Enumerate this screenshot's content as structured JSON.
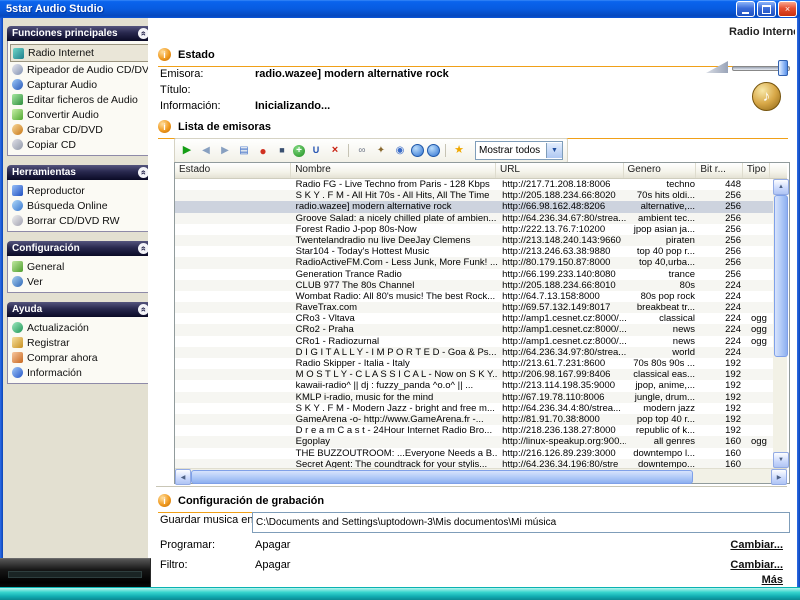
{
  "colors": {
    "accent_orange": "#F0A018",
    "title_blue": "#0A55D8",
    "selection_gray": "#CDD3DE",
    "teal_strip": "#17BFC0"
  },
  "window": {
    "title": "5star Audio Studio"
  },
  "page": {
    "section_label": "Radio Internet"
  },
  "sidebar": {
    "sections": [
      {
        "title": "Funciones principales",
        "items": [
          {
            "label": "Radio Internet",
            "icon": "radio-icon",
            "active": true
          },
          {
            "label": "Ripeador de Audio CD/DVD",
            "icon": "cd-rip-icon"
          },
          {
            "label": "Capturar Audio",
            "icon": "capture-audio-icon"
          },
          {
            "label": "Editar ficheros de Audio",
            "icon": "edit-audio-icon"
          },
          {
            "label": "Convertir Audio",
            "icon": "convert-audio-icon"
          },
          {
            "label": "Grabar CD/DVD",
            "icon": "burn-cd-icon"
          },
          {
            "label": "Copiar CD",
            "icon": "copy-cd-icon"
          }
        ]
      },
      {
        "title": "Herramientas",
        "items": [
          {
            "label": "Reproductor",
            "icon": "player-icon"
          },
          {
            "label": "Búsqueda Online",
            "icon": "online-search-icon"
          },
          {
            "label": "Borrar CD/DVD RW",
            "icon": "erase-cd-icon"
          }
        ]
      },
      {
        "title": "Configuración",
        "items": [
          {
            "label": "General",
            "icon": "general-icon"
          },
          {
            "label": "Ver",
            "icon": "view-icon"
          }
        ]
      },
      {
        "title": "Ayuda",
        "items": [
          {
            "label": "Actualización",
            "icon": "update-icon"
          },
          {
            "label": "Registrar",
            "icon": "register-icon"
          },
          {
            "label": "Comprar ahora",
            "icon": "buy-icon"
          },
          {
            "label": "Información",
            "icon": "info-item-icon"
          }
        ]
      }
    ]
  },
  "main": {
    "estado": {
      "title": "Estado",
      "fields": [
        {
          "label": "Emisora:",
          "value": "radio.wazee] modern alternative rock"
        },
        {
          "label": "Título:",
          "value": ""
        },
        {
          "label": "Información:",
          "value": "Inicializando..."
        }
      ]
    },
    "lista": {
      "title": "Lista de emisoras",
      "toolbar": {
        "buttons": [
          "play",
          "previous",
          "next",
          "playlist",
          "record",
          "stop",
          "add",
          "add-url",
          "delete",
          "connect",
          "tools",
          "preview",
          "internet",
          "online",
          "favorites"
        ],
        "filter_value": "Mostrar todos"
      },
      "columns": [
        {
          "label": "Estado",
          "key": "estado"
        },
        {
          "label": "Nombre",
          "key": "nombre"
        },
        {
          "label": "URL",
          "key": "url"
        },
        {
          "label": "Genero",
          "key": "genero"
        },
        {
          "label": "Bit r...",
          "key": "bit"
        },
        {
          "label": "Tipo",
          "key": "tipo"
        }
      ],
      "selected_index": 2,
      "rows": [
        {
          "estado": "",
          "nombre": "Radio FG - Live Techno from Paris - 128 Kbps",
          "url": "http://217.71.208.18:8006",
          "genero": "techno",
          "bit": "448",
          "tipo": ""
        },
        {
          "estado": "",
          "nombre": "S K Y . F M - All Hit 70s - All Hits, All The Time",
          "url": "http://205.188.234.66:8020",
          "genero": "70s hits oldi...",
          "bit": "256",
          "tipo": ""
        },
        {
          "estado": "",
          "nombre": "radio.wazee] modern alternative rock",
          "url": "http://66.98.162.48:8206",
          "genero": "alternative,...",
          "bit": "256",
          "tipo": ""
        },
        {
          "estado": "",
          "nombre": "Groove Salad: a nicely chilled plate of ambien...",
          "url": "http://64.236.34.67:80/strea...",
          "genero": "ambient tec...",
          "bit": "256",
          "tipo": ""
        },
        {
          "estado": "",
          "nombre": "Forest Radio J-pop 80s-Now",
          "url": "http://222.13.76.7:10200",
          "genero": "jpop asian ja...",
          "bit": "256",
          "tipo": ""
        },
        {
          "estado": "",
          "nombre": "Twentelandradio nu live DeeJay Clemens",
          "url": "http://213.148.240.143:9660",
          "genero": "piraten",
          "bit": "256",
          "tipo": ""
        },
        {
          "estado": "",
          "nombre": "Star104 - Today's Hottest Music",
          "url": "http://213.246.63.38:9880",
          "genero": "top 40 pop r...",
          "bit": "256",
          "tipo": ""
        },
        {
          "estado": "",
          "nombre": "RadioActiveFM.Com - Less Junk, More Funk! ...",
          "url": "http://80.179.150.87:8000",
          "genero": "top 40,urba...",
          "bit": "256",
          "tipo": ""
        },
        {
          "estado": "",
          "nombre": "Generation Trance Radio",
          "url": "http://66.199.233.140:8080",
          "genero": "trance",
          "bit": "256",
          "tipo": ""
        },
        {
          "estado": "",
          "nombre": "CLUB 977 The 80s Channel",
          "url": "http://205.188.234.66:8010",
          "genero": "80s",
          "bit": "224",
          "tipo": ""
        },
        {
          "estado": "",
          "nombre": "Wombat Radio: All 80's music! The best Rock...",
          "url": "http://64.7.13.158:8000",
          "genero": "80s pop rock",
          "bit": "224",
          "tipo": ""
        },
        {
          "estado": "",
          "nombre": "RaveTrax.com",
          "url": "http://69.57.132.149:8017",
          "genero": "breakbeat tr...",
          "bit": "224",
          "tipo": ""
        },
        {
          "estado": "",
          "nombre": "CRo3 - Vltava",
          "url": "http://amp1.cesnet.cz:8000/...",
          "genero": "classical",
          "bit": "224",
          "tipo": "ogg"
        },
        {
          "estado": "",
          "nombre": "CRo2 - Praha",
          "url": "http://amp1.cesnet.cz:8000/...",
          "genero": "news",
          "bit": "224",
          "tipo": "ogg"
        },
        {
          "estado": "",
          "nombre": "CRo1 - Radiozurnal",
          "url": "http://amp1.cesnet.cz:8000/...",
          "genero": "news",
          "bit": "224",
          "tipo": "ogg"
        },
        {
          "estado": "",
          "nombre": "D I G I T A L L Y - I M P O R T E D - Goa & Ps...",
          "url": "http://64.236.34.97:80/strea...",
          "genero": "world",
          "bit": "224",
          "tipo": ""
        },
        {
          "estado": "",
          "nombre": "Radio Skipper - Italia - Italy",
          "url": "http://213.61.7.231:8600",
          "genero": "70s 80s 90s ...",
          "bit": "192",
          "tipo": ""
        },
        {
          "estado": "",
          "nombre": "M O S T L Y - C L A S S I C A L - Now on S K Y...",
          "url": "http://206.98.167.99:8406",
          "genero": "classical eas...",
          "bit": "192",
          "tipo": ""
        },
        {
          "estado": "",
          "nombre": "kawaii-radio^ || dj : fuzzy_panda ^o.o^ || ...",
          "url": "http://213.114.198.35:9000",
          "genero": "jpop, anime,...",
          "bit": "192",
          "tipo": ""
        },
        {
          "estado": "",
          "nombre": "KMLP i-radio, music for the mind",
          "url": "http://67.19.78.110:8006",
          "genero": "jungle, drum...",
          "bit": "192",
          "tipo": ""
        },
        {
          "estado": "",
          "nombre": "S K Y . F M - Modern Jazz - bright and free m...",
          "url": "http://64.236.34.4:80/strea...",
          "genero": "modern jazz",
          "bit": "192",
          "tipo": ""
        },
        {
          "estado": "",
          "nombre": "GameArena -o- http://www.GameArena.fr -...",
          "url": "http://81.91.70.38:8000",
          "genero": "pop top 40 r...",
          "bit": "192",
          "tipo": ""
        },
        {
          "estado": "",
          "nombre": "D r e a m C a s t - 24Hour Internet Radio Bro...",
          "url": "http://218.236.138.27:8000",
          "genero": "republic of k...",
          "bit": "192",
          "tipo": ""
        },
        {
          "estado": "",
          "nombre": "Egoplay",
          "url": "http://linux-speakup.org:900...",
          "genero": "all genres",
          "bit": "160",
          "tipo": "ogg"
        },
        {
          "estado": "",
          "nombre": "THE BUZZOUTROOM: ...Everyone Needs a B...",
          "url": "http://216.126.89.239:3000",
          "genero": "downtempo l...",
          "bit": "160",
          "tipo": ""
        },
        {
          "estado": "",
          "nombre": "Secret Agent: The coundtrack for your stylis...",
          "url": "http://64.236.34.196:80/stre",
          "genero": "downtempo...",
          "bit": "160",
          "tipo": ""
        }
      ]
    },
    "grabacion": {
      "title": "Configuración de grabación",
      "save_label": "Guardar musica en:",
      "save_path": "C:\\Documents and Settings\\uptodown-3\\Mis documentos\\Mi música",
      "programar_label": "Programar:",
      "programar_value": "Apagar",
      "filtro_label": "Filtro:",
      "filtro_value": "Apagar",
      "cambiar_label": "Cambiar...",
      "mas_label": "Más"
    }
  }
}
